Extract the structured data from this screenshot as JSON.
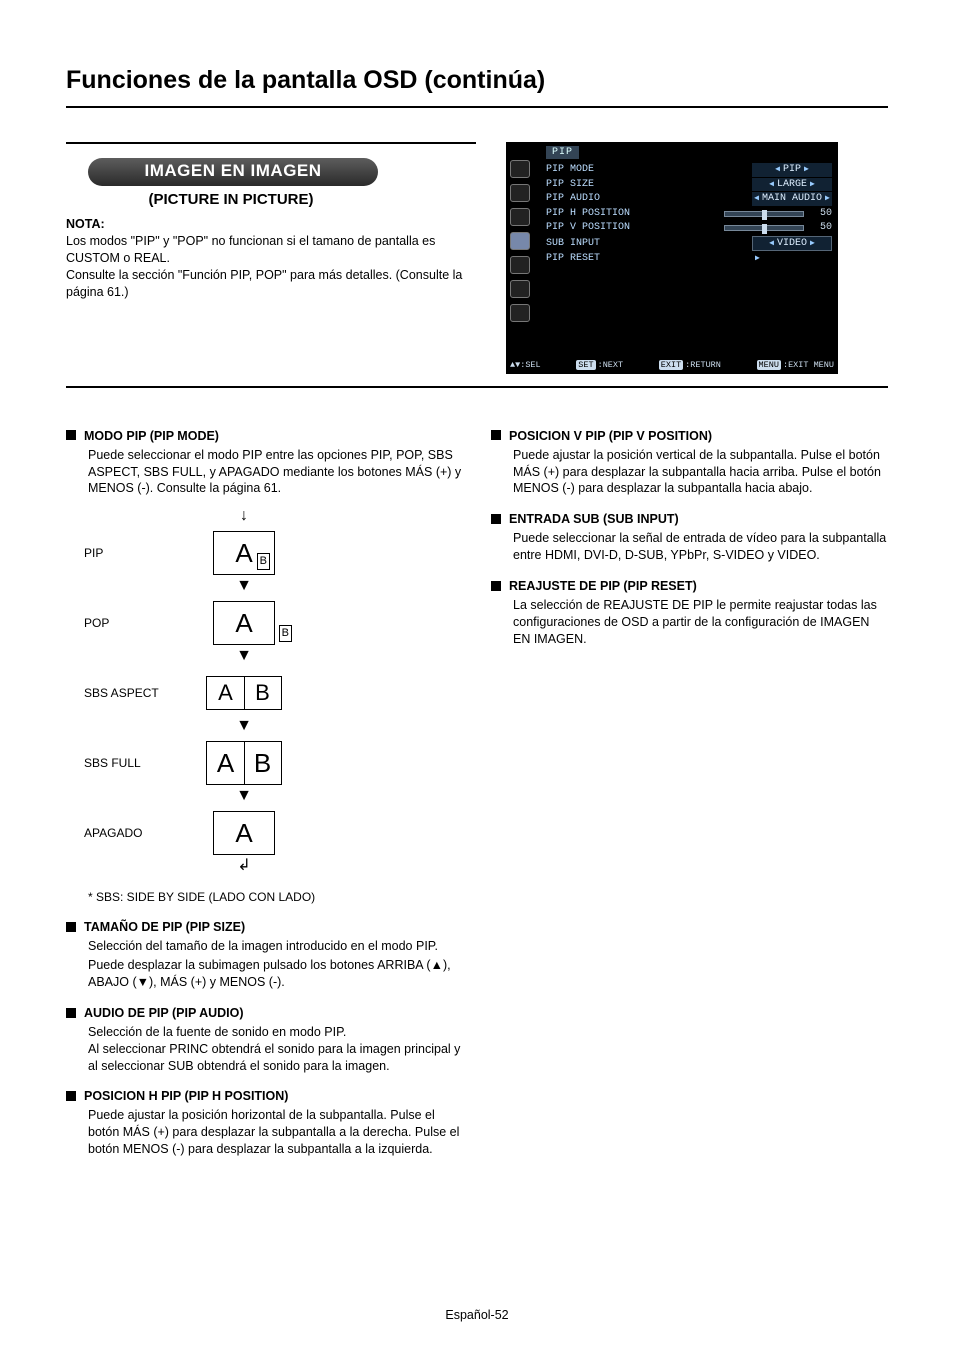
{
  "page_title": "Funciones de la pantalla OSD (continúa)",
  "banner": {
    "pill": "IMAGEN EN IMAGEN",
    "subtitle": "(PICTURE IN PICTURE)",
    "nota_label": "NOTA:",
    "nota_line1": "Los modos \"PIP\" y \"POP\" no funcionan si el tamano de pantalla es CUSTOM o REAL.",
    "nota_line2": "Consulte la sección \"Función PIP, POP\" para más detalles. (Consulte la página 61.)"
  },
  "osd": {
    "title": "PIP",
    "rows": [
      {
        "label": "PIP MODE",
        "value": "PIP",
        "style": "bracket"
      },
      {
        "label": "PIP SIZE",
        "value": "LARGE",
        "style": "bracket"
      },
      {
        "label": "PIP AUDIO",
        "value": "MAIN AUDIO",
        "style": "bracket"
      },
      {
        "label": "PIP H POSITION",
        "value": "50",
        "style": "slider"
      },
      {
        "label": "PIP V POSITION",
        "value": "50",
        "style": "slider"
      },
      {
        "label": "SUB INPUT",
        "value": "VIDEO",
        "style": "box"
      },
      {
        "label": "PIP RESET",
        "value": "",
        "style": "arrow-only"
      }
    ],
    "footer": {
      "sel": "SEL",
      "next": "NEXT",
      "ret": "RETURN",
      "exit": "EXIT MENU",
      "k_updown": "▲▼:",
      "k_set": "SET",
      "k_exit": "EXIT",
      "k_menu": "MENU"
    }
  },
  "modes": {
    "items": [
      {
        "label": "PIP"
      },
      {
        "label": "POP"
      },
      {
        "label": "SBS ASPECT"
      },
      {
        "label": "SBS FULL"
      },
      {
        "label": "APAGADO"
      }
    ],
    "footnote": "* SBS: SIDE BY SIDE (LADO CON LADO)"
  },
  "left": {
    "modo_pip_h": "MODO PIP (PIP MODE)",
    "modo_pip_b": "Puede seleccionar el modo PIP entre las opciones PIP, POP, SBS ASPECT, SBS FULL, y APAGADO mediante los botones MÁS (+) y MENOS (-). Consulte la página 61.",
    "tam_h": "TAMAÑO DE PIP (PIP SIZE)",
    "tam_b1": "Selección del tamaño de la imagen introducido en el modo PIP.",
    "tam_b2": "Puede desplazar la subimagen pulsado los botones ARRIBA (▲), ABAJO (▼), MÁS (+) y MENOS (-).",
    "aud_h": "AUDIO DE PIP (PIP AUDIO)",
    "aud_b": "Selección de la fuente de sonido en modo PIP.\nAl seleccionar PRINC obtendrá el sonido para la imagen principal y al seleccionar SUB obtendrá el sonido para la imagen.",
    "hpos_h": "POSICION H PIP (PIP H POSITION)",
    "hpos_b": "Puede ajustar la posición horizontal de la subpantalla. Pulse el botón MÁS (+) para desplazar la subpantalla a la derecha. Pulse el botón MENOS (-) para desplazar la subpantalla a la izquierda."
  },
  "right": {
    "vpos_h": "POSICION V PIP (PIP V POSITION)",
    "vpos_b": "Puede ajustar la posición vertical de la subpantalla. Pulse el botón MÁS (+) para desplazar la subpantalla hacia arriba. Pulse el botón MENOS (-) para desplazar la subpantalla hacia abajo.",
    "sub_h": "ENTRADA SUB (SUB INPUT)",
    "sub_b": "Puede seleccionar la señal de entrada de vídeo para la subpantalla entre HDMI, DVI-D, D-SUB, YPbPr, S-VIDEO y VIDEO.",
    "rst_h": "REAJUSTE DE PIP (PIP RESET)",
    "rst_b": "La selección de REAJUSTE DE PIP le permite reajustar todas las configuraciones de OSD a partir de la configuración de IMAGEN EN IMAGEN."
  },
  "page_number": "Español-52"
}
